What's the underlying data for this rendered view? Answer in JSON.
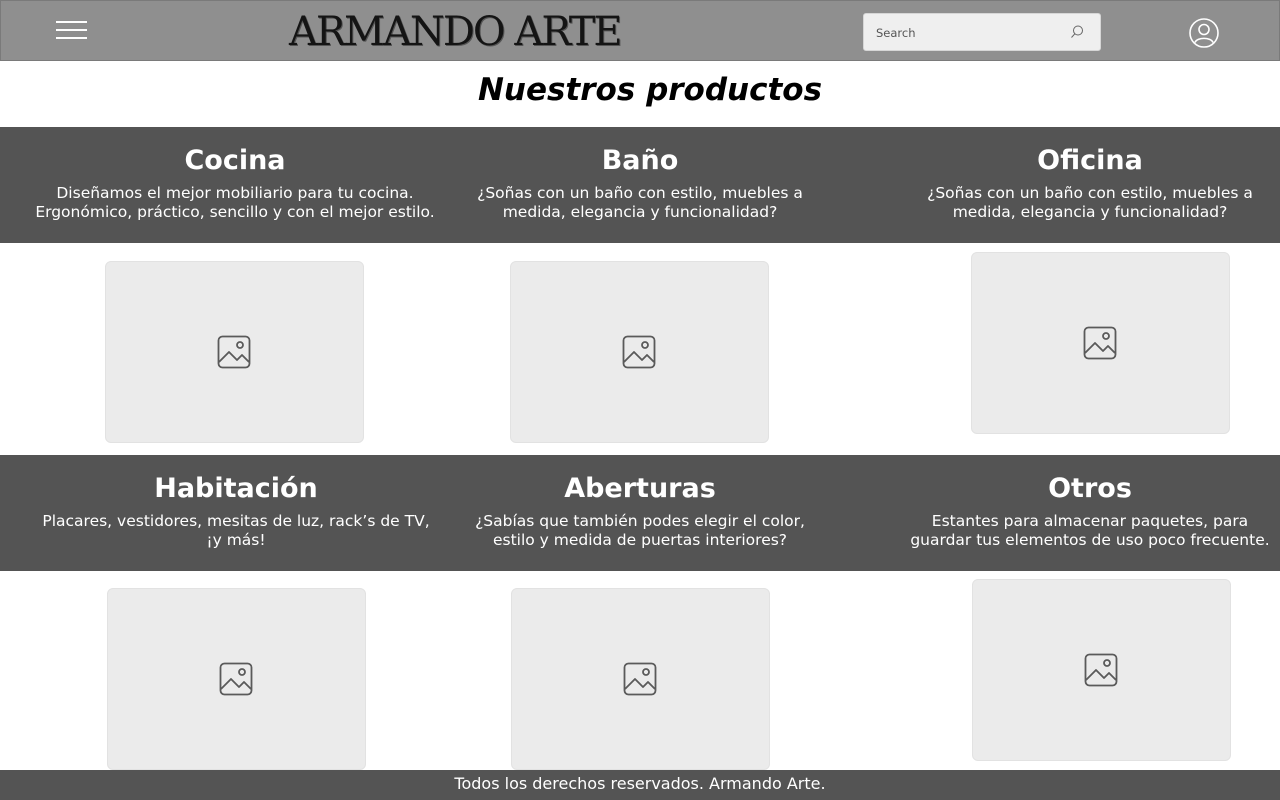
{
  "header": {
    "logo": "ARMANDO ARTE",
    "search_placeholder": "Search",
    "menu_icon": "hamburger-menu-icon",
    "search_icon": "search-icon",
    "user_icon": "user-icon"
  },
  "main": {
    "title": "Nuestros productos",
    "categories": [
      {
        "title": "Cocina",
        "description": "Diseñamos el mejor mobiliario para tu cocina.\nErgonómico, práctico, sencillo y con el mejor estilo.",
        "image_icon": "image-placeholder-icon"
      },
      {
        "title": "Baño",
        "description": "¿Soñas con un baño con estilo, muebles a\nmedida, elegancia y funcionalidad?",
        "image_icon": "image-placeholder-icon"
      },
      {
        "title": "Oficina",
        "description": "¿Soñas con un baño con estilo, muebles a\nmedida, elegancia y funcionalidad?",
        "image_icon": "image-placeholder-icon"
      },
      {
        "title": "Habitación",
        "description": "Placares, vestidores, mesitas de luz, rack’s de TV,\n¡y más!",
        "image_icon": "image-placeholder-icon"
      },
      {
        "title": "Aberturas",
        "description": "¿Sabías que también podes elegir el color,\nestilo y medida de puertas interiores?",
        "image_icon": "image-placeholder-icon"
      },
      {
        "title": "Otros",
        "description": "Estantes para almacenar paquetes, para\nguardar tus elementos de uso poco frecuente.",
        "image_icon": "image-placeholder-icon"
      }
    ]
  },
  "footer": {
    "text": "Todos los derechos reservados. Armando Arte."
  },
  "colors": {
    "header_bg": "#8f8f8f",
    "band_bg": "#545454",
    "placeholder_bg": "#ebebeb",
    "footer_bg": "#545454"
  }
}
